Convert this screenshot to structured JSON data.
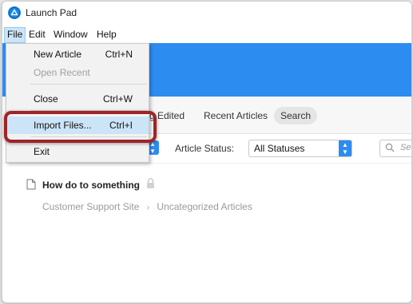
{
  "window": {
    "title": "Launch Pad"
  },
  "menubar": {
    "items": [
      "File",
      "Edit",
      "Window",
      "Help"
    ]
  },
  "file_menu": {
    "items": [
      {
        "label": "New Article",
        "shortcut": "Ctrl+N"
      },
      {
        "label": "Open Recent",
        "shortcut": ""
      },
      {
        "label": "Close",
        "shortcut": "Ctrl+W"
      },
      {
        "label": "Import Files...",
        "shortcut": "Ctrl+I"
      },
      {
        "label": "Exit",
        "shortcut": ""
      }
    ]
  },
  "tabs": {
    "items": [
      "g Edited",
      "Recent Articles",
      "Search"
    ]
  },
  "filters": {
    "status_label": "Article Status:",
    "status_value": "All Statuses",
    "search_placeholder": "Sea"
  },
  "article": {
    "title": "How do to something",
    "breadcrumb": [
      "Customer Support Site",
      "Uncategorized Articles"
    ],
    "breadcrumb_separator": "›"
  },
  "colors": {
    "accent": "#2d8cf0",
    "highlight_ring": "#a02428",
    "menu_hover": "#cce4f7"
  }
}
